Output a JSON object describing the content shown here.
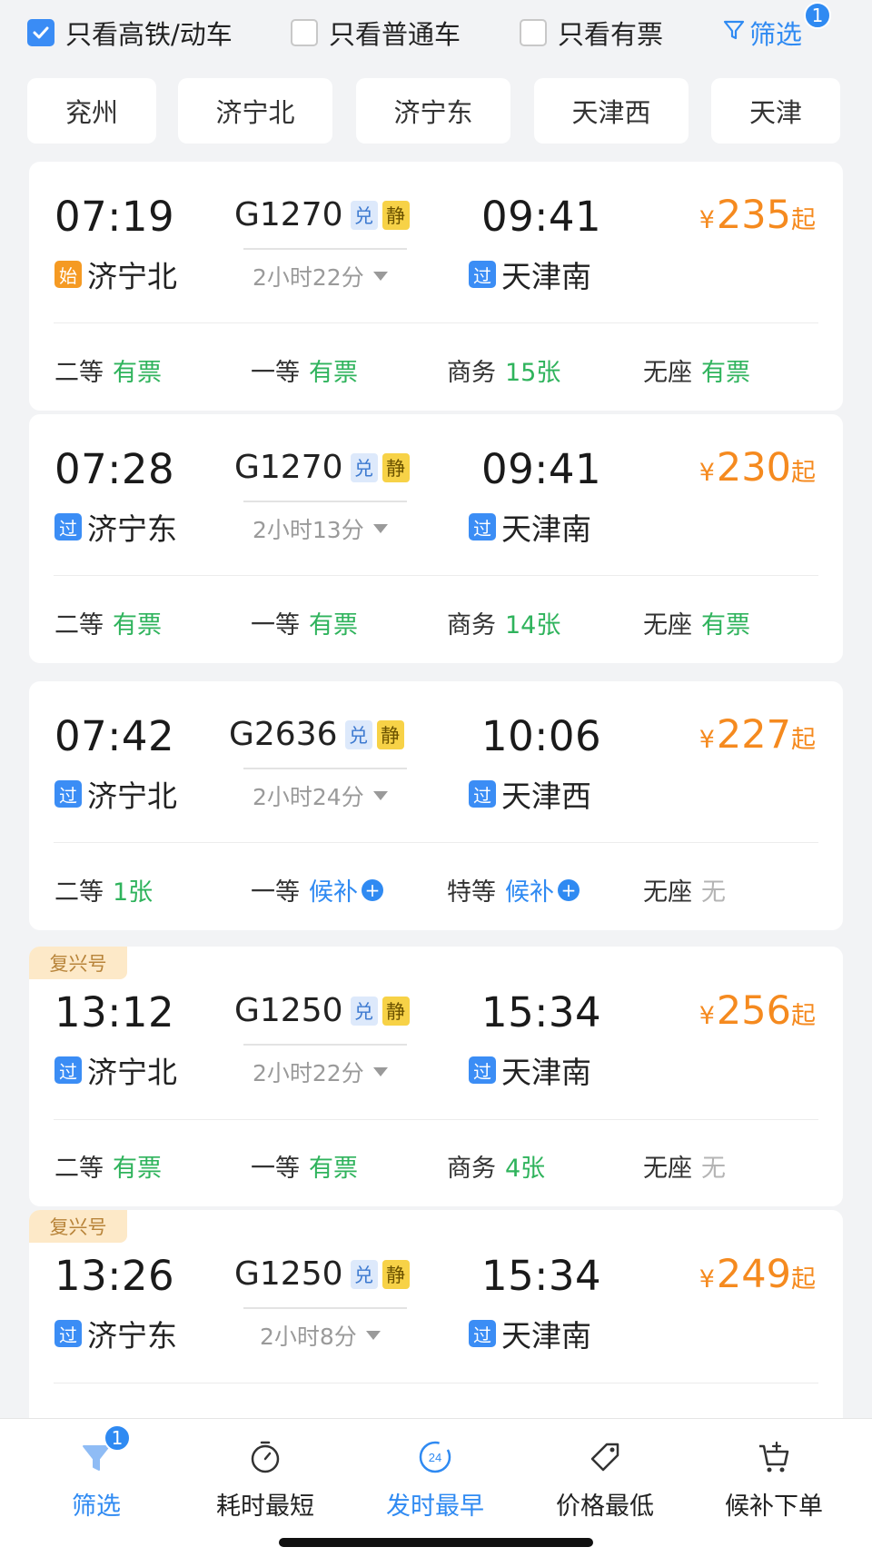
{
  "filters": {
    "high_speed_only": {
      "label": "只看高铁/动车",
      "checked": true
    },
    "normal_only": {
      "label": "只看普通车",
      "checked": false
    },
    "available_only": {
      "label": "只看有票",
      "checked": false
    },
    "filter_button": {
      "label": "筛选",
      "badge": "1"
    }
  },
  "stations": [
    "兖州",
    "济宁北",
    "济宁东",
    "天津西",
    "天津"
  ],
  "trains": [
    {
      "fuxing_tag": "",
      "depart_time": "07:19",
      "depart_station": "济宁北",
      "depart_marker": "始",
      "train_no": "G1270",
      "badge_dui": "兑",
      "badge_jing": "静",
      "duration": "2小时22分",
      "arrive_time": "09:41",
      "arrive_station": "天津南",
      "arrive_marker": "过",
      "price_symbol": "¥",
      "price": "235",
      "price_suffix": "起",
      "seats": [
        {
          "name": "二等",
          "value": "有票",
          "status": "green"
        },
        {
          "name": "一等",
          "value": "有票",
          "status": "green"
        },
        {
          "name": "商务",
          "value": "15张",
          "status": "green"
        },
        {
          "name": "无座",
          "value": "有票",
          "status": "green"
        }
      ]
    },
    {
      "fuxing_tag": "",
      "depart_time": "07:28",
      "depart_station": "济宁东",
      "depart_marker": "过",
      "train_no": "G1270",
      "badge_dui": "兑",
      "badge_jing": "静",
      "duration": "2小时13分",
      "arrive_time": "09:41",
      "arrive_station": "天津南",
      "arrive_marker": "过",
      "price_symbol": "¥",
      "price": "230",
      "price_suffix": "起",
      "seats": [
        {
          "name": "二等",
          "value": "有票",
          "status": "green"
        },
        {
          "name": "一等",
          "value": "有票",
          "status": "green"
        },
        {
          "name": "商务",
          "value": "14张",
          "status": "green"
        },
        {
          "name": "无座",
          "value": "有票",
          "status": "green"
        }
      ]
    },
    {
      "fuxing_tag": "",
      "depart_time": "07:42",
      "depart_station": "济宁北",
      "depart_marker": "过",
      "train_no": "G2636",
      "badge_dui": "兑",
      "badge_jing": "静",
      "duration": "2小时24分",
      "arrive_time": "10:06",
      "arrive_station": "天津西",
      "arrive_marker": "过",
      "price_symbol": "¥",
      "price": "227",
      "price_suffix": "起",
      "seats": [
        {
          "name": "二等",
          "value": "1张",
          "status": "green"
        },
        {
          "name": "一等",
          "value": "候补",
          "status": "blue"
        },
        {
          "name": "特等",
          "value": "候补",
          "status": "blue"
        },
        {
          "name": "无座",
          "value": "无",
          "status": "grey"
        }
      ]
    },
    {
      "fuxing_tag": "复兴号",
      "depart_time": "13:12",
      "depart_station": "济宁北",
      "depart_marker": "过",
      "train_no": "G1250",
      "badge_dui": "兑",
      "badge_jing": "静",
      "duration": "2小时22分",
      "arrive_time": "15:34",
      "arrive_station": "天津南",
      "arrive_marker": "过",
      "price_symbol": "¥",
      "price": "256",
      "price_suffix": "起",
      "seats": [
        {
          "name": "二等",
          "value": "有票",
          "status": "green"
        },
        {
          "name": "一等",
          "value": "有票",
          "status": "green"
        },
        {
          "name": "商务",
          "value": "4张",
          "status": "green"
        },
        {
          "name": "无座",
          "value": "无",
          "status": "grey"
        }
      ]
    },
    {
      "fuxing_tag": "复兴号",
      "depart_time": "13:26",
      "depart_station": "济宁东",
      "depart_marker": "过",
      "train_no": "G1250",
      "badge_dui": "兑",
      "badge_jing": "静",
      "duration": "2小时8分",
      "arrive_time": "15:34",
      "arrive_station": "天津南",
      "arrive_marker": "过",
      "price_symbol": "¥",
      "price": "249",
      "price_suffix": "起"
    }
  ],
  "bottom_tabs": [
    {
      "label": "筛选",
      "icon": "filter-icon",
      "badge": "1",
      "active": true
    },
    {
      "label": "耗时最短",
      "icon": "stopwatch-icon",
      "active": false
    },
    {
      "label": "发时最早",
      "icon": "clock-24-icon",
      "icon_text": "24",
      "active": true
    },
    {
      "label": "价格最低",
      "icon": "price-tag-icon",
      "active": false
    },
    {
      "label": "候补下单",
      "icon": "cart-plus-icon",
      "active": false
    }
  ],
  "colors": {
    "accent_blue": "#2f8af2",
    "price_orange": "#f58a1f",
    "available_green": "#2fb35c",
    "unavailable_grey": "#b4b4b4"
  }
}
